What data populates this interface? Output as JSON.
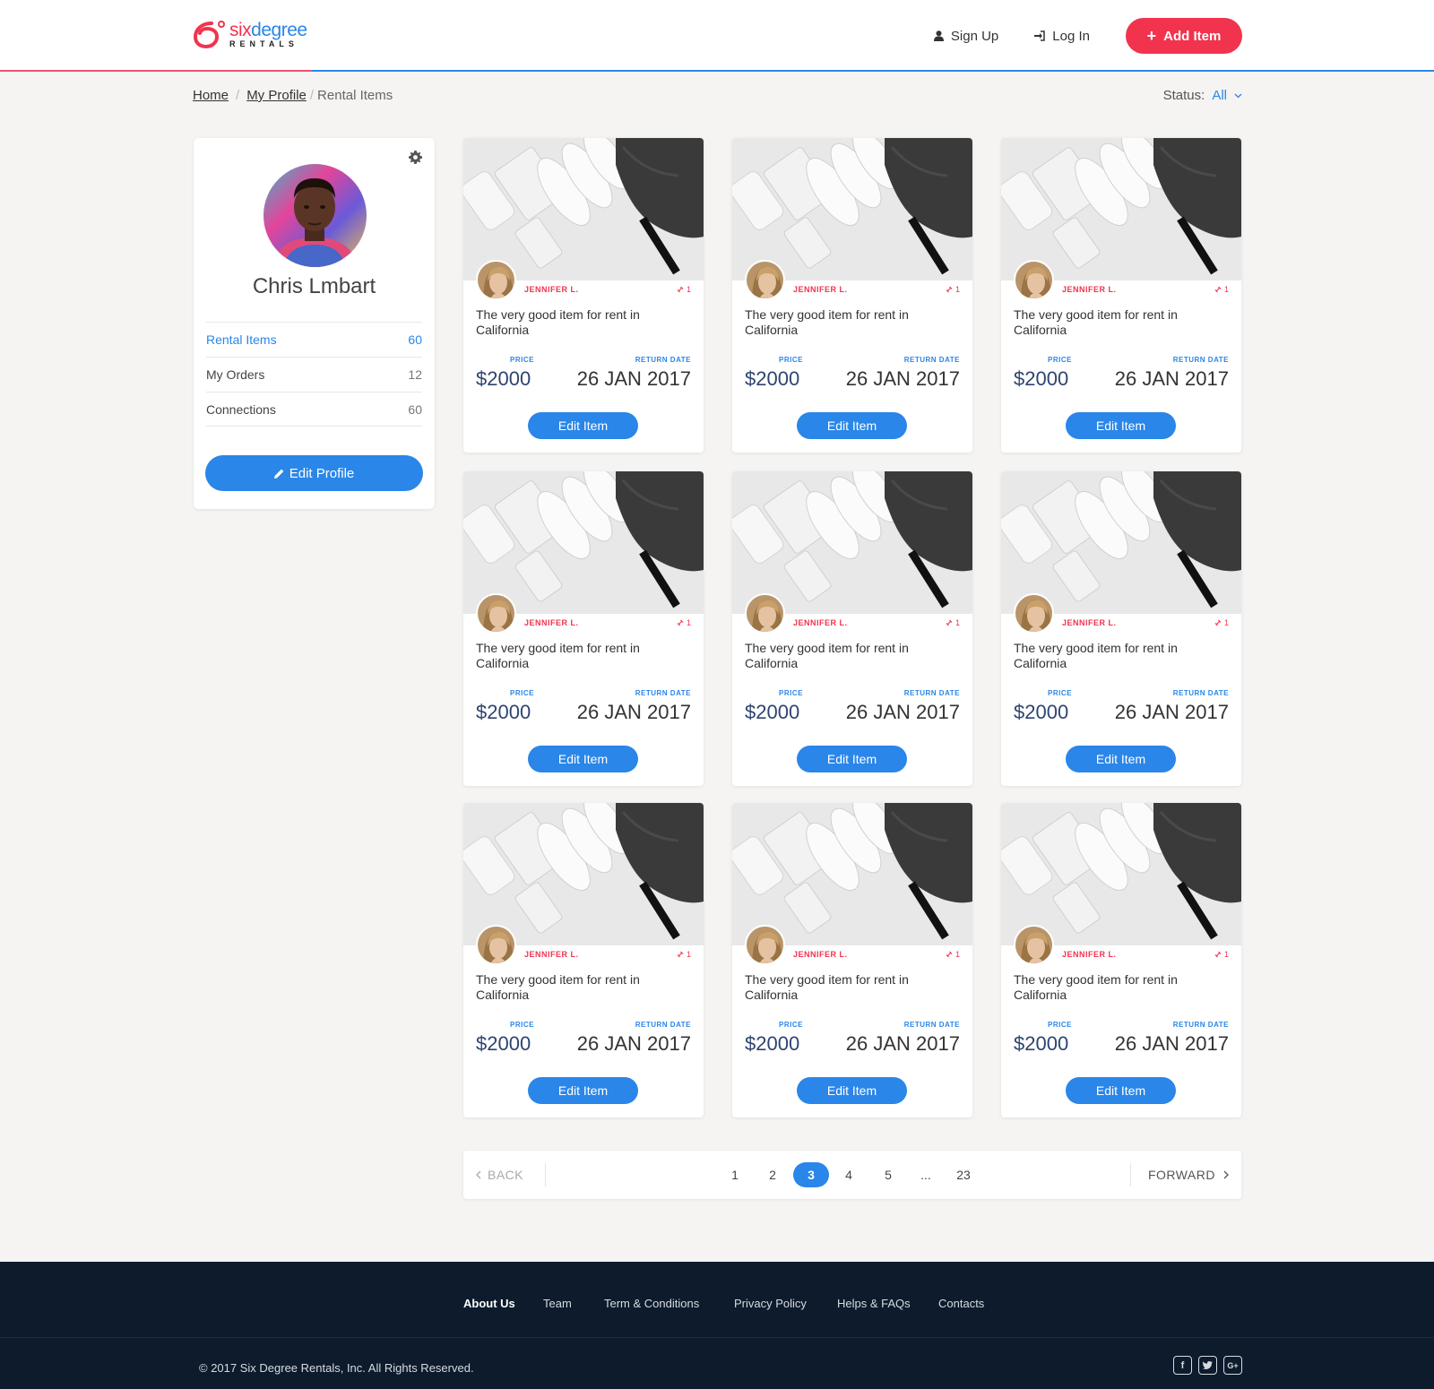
{
  "brand": {
    "six": "six",
    "degree": "degree",
    "rentals": "RENTALS"
  },
  "nav": {
    "sign_up": "Sign Up",
    "log_in": "Log In",
    "add_item": "Add Item"
  },
  "breadcrumb": {
    "home": "Home",
    "profile": "My Profile",
    "current": "Rental Items"
  },
  "status": {
    "label": "Status:",
    "value": "All"
  },
  "profile": {
    "name": "Chris Lmbart",
    "items": [
      {
        "label": "Rental Items",
        "count": "60"
      },
      {
        "label": "My Orders",
        "count": "12"
      },
      {
        "label": "Connections",
        "count": "60"
      }
    ],
    "edit_label": "Edit Profile"
  },
  "items": [
    {
      "owner": "JENNIFER L.",
      "count": "1",
      "title": "The very good item for rent in California",
      "price_label": "PRICE",
      "price": "$2000",
      "date_label": "RETURN DATE",
      "date": "26 JAN 2017",
      "button": "Edit Item"
    },
    {
      "owner": "JENNIFER L.",
      "count": "1",
      "title": "The very good item for rent in California",
      "price_label": "PRICE",
      "price": "$2000",
      "date_label": "RETURN DATE",
      "date": "26 JAN 2017",
      "button": "Edit Item"
    },
    {
      "owner": "JENNIFER L.",
      "count": "1",
      "title": "The very good item for rent in California",
      "price_label": "PRICE",
      "price": "$2000",
      "date_label": "RETURN DATE",
      "date": "26 JAN 2017",
      "button": "Edit Item"
    },
    {
      "owner": "JENNIFER L.",
      "count": "1",
      "title": "The very good item for rent in California",
      "price_label": "PRICE",
      "price": "$2000",
      "date_label": "RETURN DATE",
      "date": "26 JAN 2017",
      "button": "Edit Item"
    },
    {
      "owner": "JENNIFER L.",
      "count": "1",
      "title": "The very good item for rent in California",
      "price_label": "PRICE",
      "price": "$2000",
      "date_label": "RETURN DATE",
      "date": "26 JAN 2017",
      "button": "Edit Item"
    },
    {
      "owner": "JENNIFER L.",
      "count": "1",
      "title": "The very good item for rent in California",
      "price_label": "PRICE",
      "price": "$2000",
      "date_label": "RETURN DATE",
      "date": "26 JAN 2017",
      "button": "Edit Item"
    },
    {
      "owner": "JENNIFER L.",
      "count": "1",
      "title": "The very good item for rent in California",
      "price_label": "PRICE",
      "price": "$2000",
      "date_label": "RETURN DATE",
      "date": "26 JAN 2017",
      "button": "Edit Item"
    },
    {
      "owner": "JENNIFER L.",
      "count": "1",
      "title": "The very good item for rent in California",
      "price_label": "PRICE",
      "price": "$2000",
      "date_label": "RETURN DATE",
      "date": "26 JAN 2017",
      "button": "Edit Item"
    },
    {
      "owner": "JENNIFER L.",
      "count": "1",
      "title": "The very good item for rent in California",
      "price_label": "PRICE",
      "price": "$2000",
      "date_label": "RETURN DATE",
      "date": "26 JAN 2017",
      "button": "Edit Item"
    }
  ],
  "pagination": {
    "back": "BACK",
    "forward": "FORWARD",
    "pages": [
      "1",
      "2",
      "3",
      "4",
      "5",
      "...",
      "23"
    ],
    "current": "3"
  },
  "footer": {
    "links": [
      "About Us",
      "Team",
      "Term & Conditions",
      "Privacy Policy",
      "Helps & FAQs",
      "Contacts"
    ],
    "copyright": "© 2017  Six Degree Rentals, Inc. All Rights Reserved.",
    "socials": [
      "facebook-icon",
      "twitter-icon",
      "google-plus-icon"
    ]
  },
  "colors": {
    "brand_red": "#f2334d",
    "brand_blue": "#2a86e8",
    "footer_bg": "#0d1b2c",
    "page_bg": "#f5f4f3"
  }
}
